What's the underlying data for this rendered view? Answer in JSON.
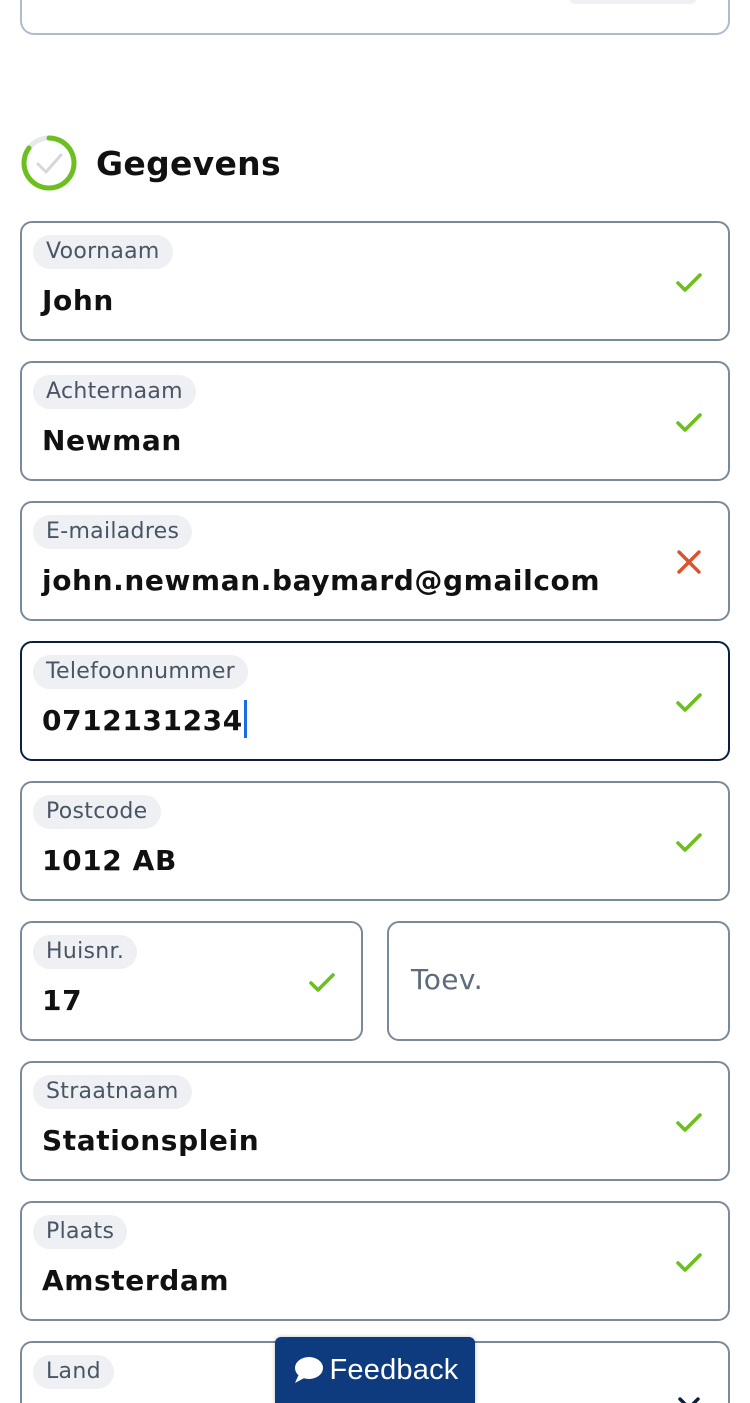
{
  "section": {
    "title": "Gegevens",
    "icon": "progress-ring-icon",
    "accent_color": "#6cbf1f"
  },
  "fields": {
    "voornaam": {
      "label": "Voornaam",
      "value": "John",
      "status": "valid"
    },
    "achternaam": {
      "label": "Achternaam",
      "value": "Newman",
      "status": "valid"
    },
    "email": {
      "label": "E-mailadres",
      "value": "john.newman.baymard@gmailcom",
      "status": "invalid"
    },
    "telefoon": {
      "label": "Telefoonnummer",
      "value": "0712131234",
      "status": "valid"
    },
    "postcode": {
      "label": "Postcode",
      "value": "1012 AB",
      "status": "valid"
    },
    "huisnr": {
      "label": "Huisnr.",
      "value": "17",
      "status": "valid"
    },
    "toevoeging": {
      "placeholder": "Toev."
    },
    "straatnaam": {
      "label": "Straatnaam",
      "value": "Stationsplein",
      "status": "valid"
    },
    "plaats": {
      "label": "Plaats",
      "value": "Amsterdam",
      "status": "valid"
    },
    "land": {
      "label": "Land",
      "status": "dropdown"
    }
  },
  "feedback": {
    "label": "Feedback",
    "icon": "speech-bubble-icon",
    "color": "#0e3b7d"
  },
  "colors": {
    "valid": "#6cbf1f",
    "invalid": "#d9532b",
    "border": "#7b8a98",
    "focus_border": "#0b1f3f"
  }
}
